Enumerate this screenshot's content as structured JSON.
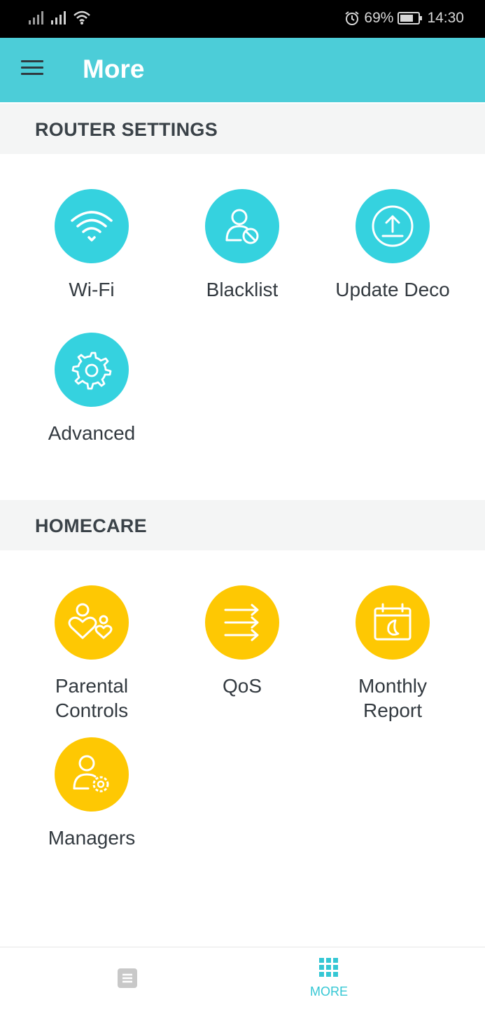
{
  "status_bar": {
    "battery": "69%",
    "time": "14:30",
    "icons": [
      "signal-icon",
      "signal-icon",
      "wifi-icon",
      "alarm-icon",
      "battery-icon"
    ]
  },
  "app_bar": {
    "title": "More",
    "menu_icon": "hamburger-menu-icon"
  },
  "router_settings": {
    "header": "ROUTER SETTINGS",
    "items": [
      {
        "label": "Wi-Fi",
        "icon": "wifi-icon"
      },
      {
        "label": "Blacklist",
        "icon": "user-block-icon"
      },
      {
        "label": "Update Deco",
        "icon": "upload-icon"
      },
      {
        "label": "Advanced",
        "icon": "gear-icon"
      }
    ]
  },
  "homecare": {
    "header": "HOMECARE",
    "items": [
      {
        "label": "Parental Controls",
        "icon": "parental-icon"
      },
      {
        "label": "QoS",
        "icon": "qos-arrows-icon"
      },
      {
        "label": "Monthly Report",
        "icon": "calendar-icon"
      },
      {
        "label": "Managers",
        "icon": "user-gear-icon"
      }
    ]
  },
  "bottom_nav": {
    "items": [
      {
        "label": "",
        "icon": "document-icon"
      },
      {
        "label": "MORE",
        "icon": "grid-icon"
      }
    ]
  },
  "colors": {
    "accent": "#4ccdd8",
    "teal_circle": "#35d2df",
    "yellow_circle": "#fec803",
    "section_bg": "#f4f5f5"
  }
}
